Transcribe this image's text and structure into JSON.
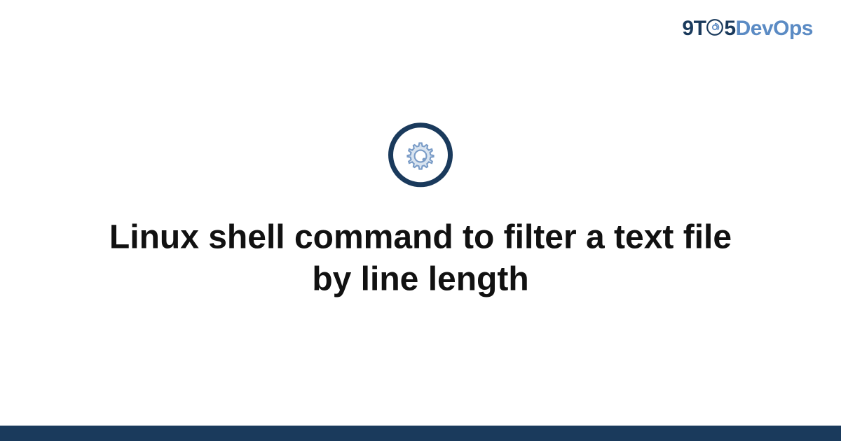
{
  "logo": {
    "part1": "9T",
    "part2": "5",
    "part3": "DevOps"
  },
  "title": "Linux shell command to filter a text file by line length",
  "colors": {
    "primary_dark": "#1a3a5c",
    "primary_light": "#5b8bc4",
    "text": "#111111"
  }
}
